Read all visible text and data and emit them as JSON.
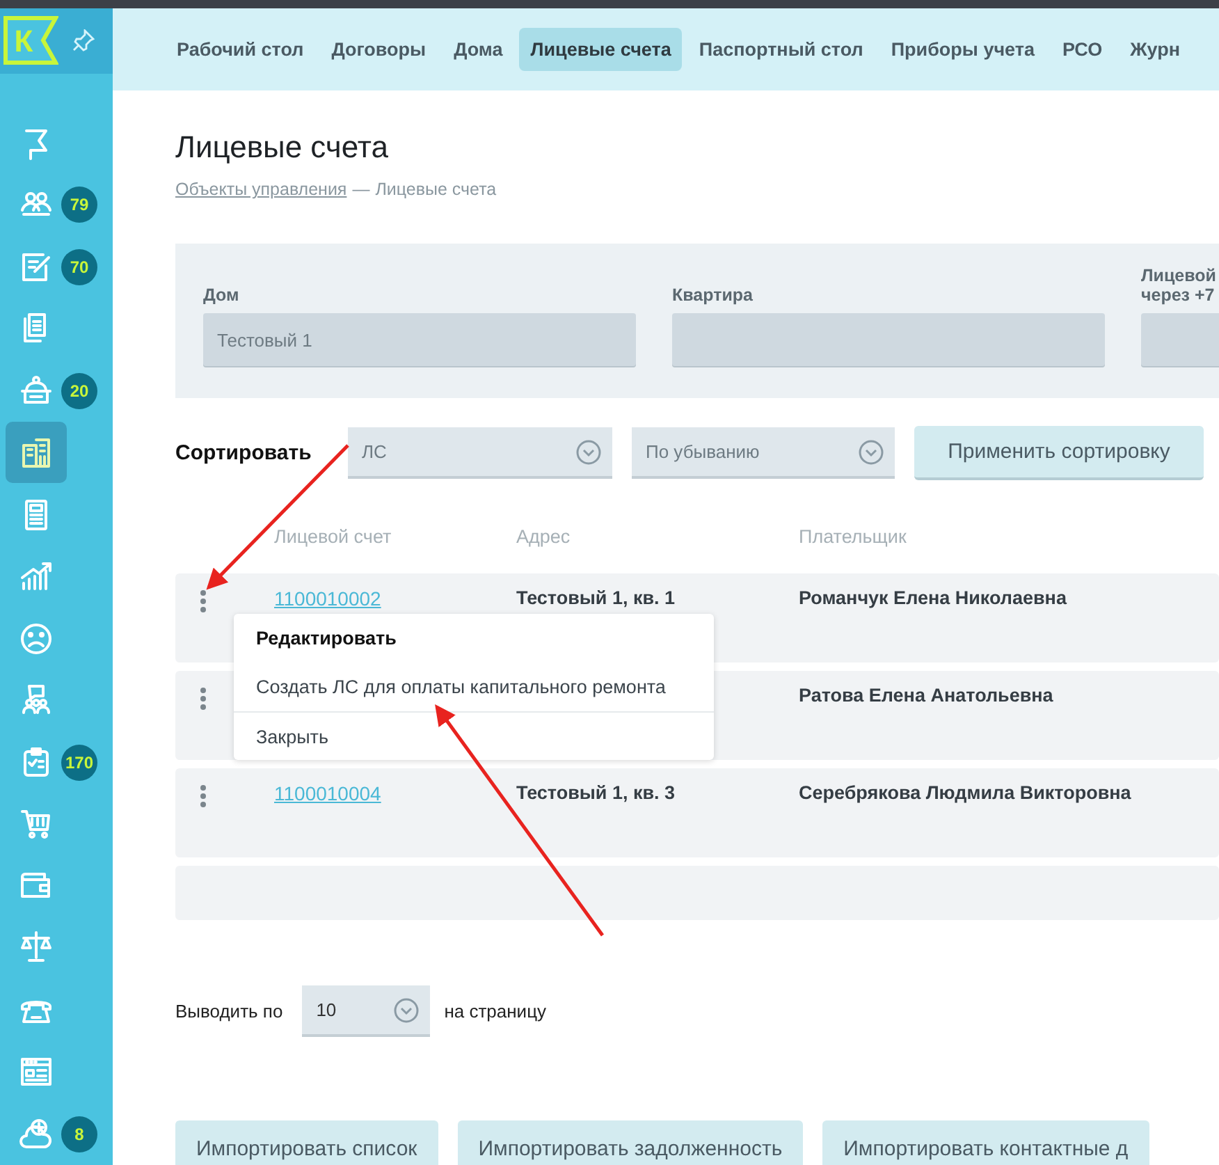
{
  "logo": {
    "letter": "К"
  },
  "sidebar": {
    "items": [
      {
        "selected": false
      },
      {
        "selected": false,
        "badge": "79"
      },
      {
        "selected": false,
        "badge": "70"
      },
      {
        "selected": false
      },
      {
        "selected": false,
        "badge": "20"
      },
      {
        "selected": true
      },
      {
        "selected": false
      },
      {
        "selected": false
      },
      {
        "selected": false
      },
      {
        "selected": false
      },
      {
        "selected": false,
        "badge": "170"
      },
      {
        "selected": false
      },
      {
        "selected": false
      },
      {
        "selected": false
      },
      {
        "selected": false
      },
      {
        "selected": false
      },
      {
        "selected": false,
        "badge": "8"
      }
    ]
  },
  "tabs": [
    {
      "label": "Рабочий стол",
      "selected": false
    },
    {
      "label": "Договоры",
      "selected": false
    },
    {
      "label": "Дома",
      "selected": false
    },
    {
      "label": "Лицевые счета",
      "selected": true
    },
    {
      "label": "Паспортный стол",
      "selected": false
    },
    {
      "label": "Приборы учета",
      "selected": false
    },
    {
      "label": "РСО",
      "selected": false
    },
    {
      "label": "Журн",
      "selected": false
    }
  ],
  "page": {
    "title": "Лицевые счета",
    "breadcrumb": {
      "link": "Объекты управления",
      "separator": "—",
      "current": "Лицевые счета"
    }
  },
  "filters": [
    {
      "label": "Дом",
      "value": "Тестовый 1"
    },
    {
      "label": "Квартира"
    },
    {
      "label": "Лицевой\nчерез +7"
    }
  ],
  "sort": {
    "label": "Сортировать",
    "field": "ЛС",
    "order": "По убыванию",
    "button": "Применить сортировку"
  },
  "table": {
    "columns": [
      "Лицевой счет",
      "Адрес",
      "Плательщик"
    ],
    "rows": [
      {
        "account": "1100010002",
        "address": "Тестовый 1, кв. 1",
        "payer": "Романчук Елена Николаевна"
      },
      {
        "payer": "Ратова Елена Анатольевна"
      },
      {
        "account": "1100010004",
        "address": "Тестовый 1, кв. 3",
        "payer": "Серебрякова Людмила Викторовна"
      }
    ]
  },
  "context_menu": {
    "items": [
      {
        "label": "Редактировать",
        "selected": true
      },
      {
        "label": "Создать ЛС для оплаты капитального ремонта",
        "selected": false
      },
      {
        "label": "Закрыть",
        "selected": false
      }
    ]
  },
  "pagination": {
    "label_before": "Выводить по",
    "value": "10",
    "label_after": "на страницу"
  },
  "actions": [
    "Импортировать список",
    "Импортировать задолженность",
    "Импортировать контактные д"
  ]
}
